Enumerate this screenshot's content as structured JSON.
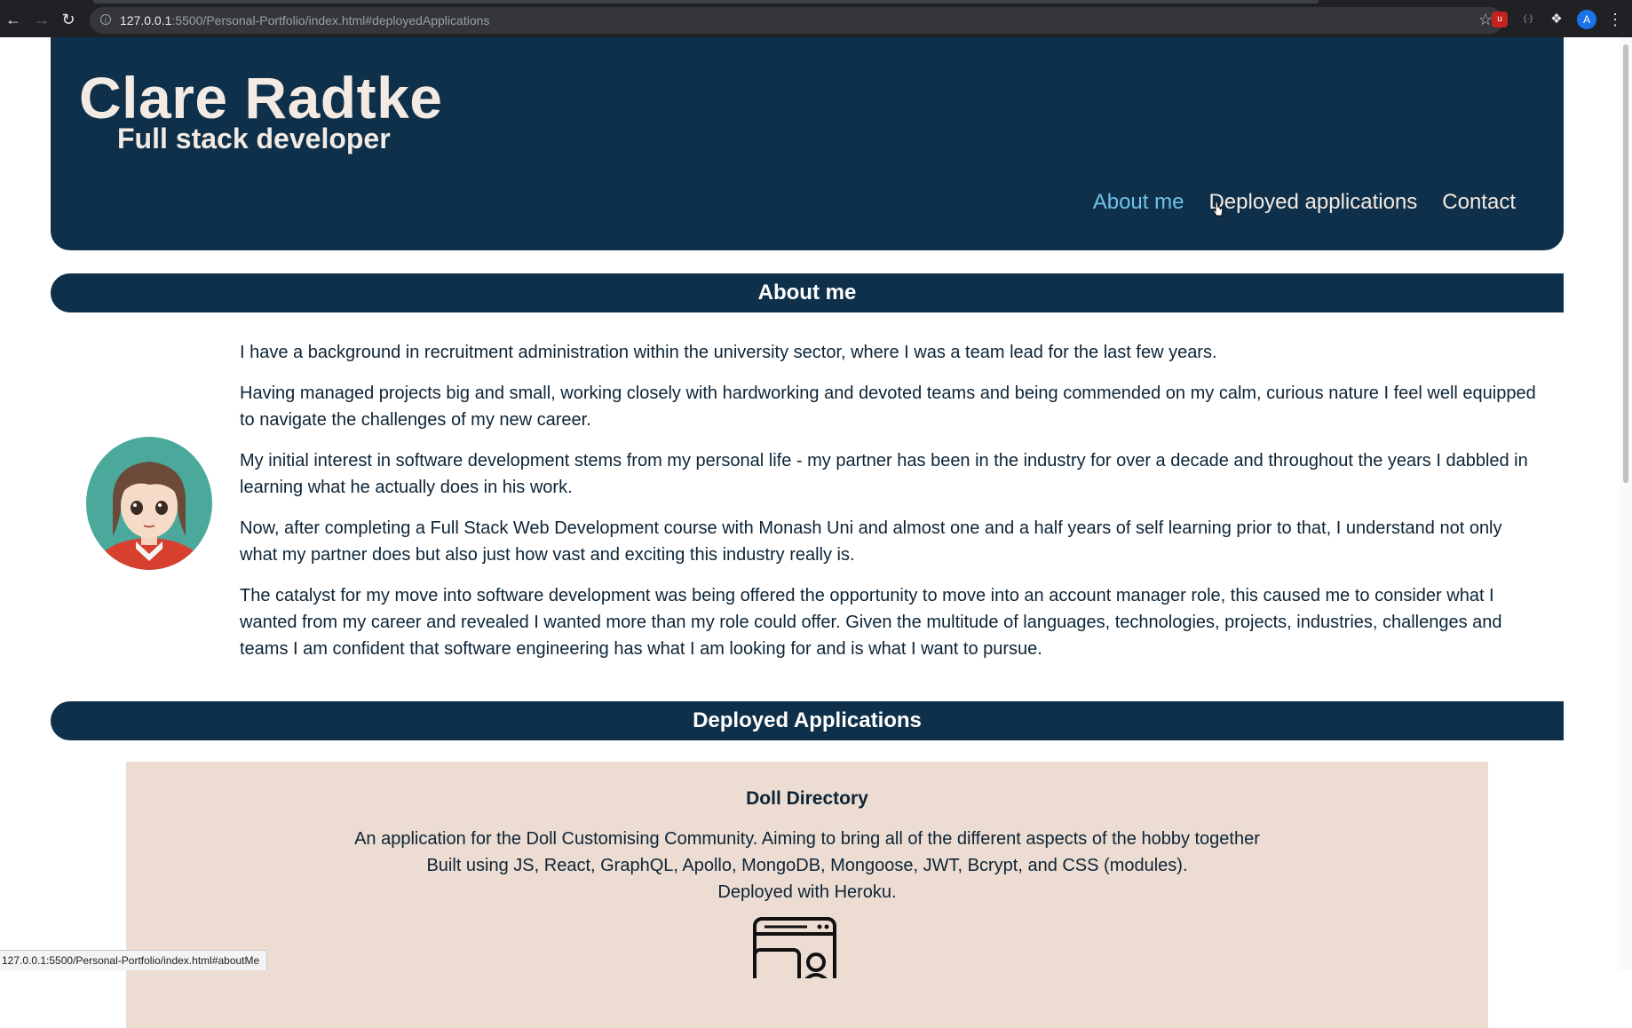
{
  "browser": {
    "url_host": "127.0.0.1",
    "url_rest": ":5500/Personal-Portfolio/index.html#deployedApplications",
    "profile_initial": "A",
    "status_url": "127.0.0.1:5500/Personal-Portfolio/index.html#aboutMe"
  },
  "header": {
    "name": "Clare Radtke",
    "role": "Full stack developer",
    "nav": [
      {
        "label": "About me",
        "active": true
      },
      {
        "label": "Deployed applications",
        "active": false
      },
      {
        "label": "Contact",
        "active": false
      }
    ]
  },
  "about": {
    "heading": "About me",
    "paragraphs": [
      "I have a background in recruitment administration within the university sector, where I was a team lead for the last few years.",
      "Having managed projects big and small, working closely with hardworking and devoted teams and being commended on my calm, curious nature I feel well equipped to navigate the challenges of my new career.",
      "My initial interest in software development stems from my personal life - my partner has been in the industry for over a decade and throughout the years I dabbled in learning what he actually does in his work.",
      "Now, after completing a Full Stack Web Development course with Monash Uni and almost one and a half years of self learning prior to that, I understand not only what my partner does but also just how vast and exciting this industry really is.",
      "The catalyst for my move into software development was being offered the opportunity to move into an account manager role, this caused me to consider what I wanted from my career and revealed I wanted more than my role could offer. Given the multitude of languages, technologies, projects, industries, challenges and teams I am confident that software engineering has what I am looking for and is what I want to pursue."
    ]
  },
  "deployed": {
    "heading": "Deployed Applications",
    "apps": [
      {
        "title": "Doll Directory",
        "line1": "An application for the Doll Customising Community. Aiming to bring all of the different aspects of the hobby together",
        "line2": "Built using JS, React, GraphQL, Apollo, MongoDB, Mongoose, JWT, Bcrypt, and CSS (modules).",
        "line3": "Deployed with Heroku."
      }
    ]
  },
  "colors": {
    "navy": "#0f304a",
    "cream": "#f3ebe3",
    "active_link": "#6fc3e6",
    "card_bg": "#ecdcd2"
  }
}
